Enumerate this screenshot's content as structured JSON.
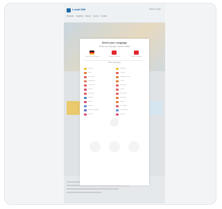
{
  "site": {
    "logo_text": "Locali NW",
    "top_link": "Partner login",
    "nav": [
      "Startseite",
      "Angebote",
      "Reisen",
      "Service",
      "Kontakt"
    ]
  },
  "language_modal": {
    "title": "Select your Language",
    "subtitle": "Choose your language / Sprache wählen",
    "primary": [
      {
        "label": "Deutschland / Deutsch",
        "color": "#1a1a1a",
        "accent": "#dd1f26"
      },
      {
        "label": "Schweiz / Deutsch",
        "color": "#e3262e"
      },
      {
        "label": "Suisse / Français",
        "color": "#e3262e"
      }
    ],
    "other_heading": "Other languages",
    "left_languages": [
      "España",
      "Italia",
      "Português",
      "Nederland",
      "Österreich",
      "Polska",
      "Danmark",
      "Sverige",
      "Norge",
      "Ελλάδα",
      "United Kingdom",
      "Россия"
    ],
    "right_languages": [
      "Belgique",
      "Türkiye",
      "Magyarország",
      "Česko",
      "Hrvatska",
      "Suomi",
      "Slovensko",
      "România",
      "Ireland",
      "България",
      "Luxembourg",
      "Србија"
    ],
    "left_colors": [
      "#f2c230",
      "#e07a2f",
      "#e0595a",
      "#e67a5a",
      "#e0595a",
      "#d9486b",
      "#e0595a",
      "#4d7bd1",
      "#d9486b",
      "#5c8fd6",
      "#5d6fc4",
      "#d9486b"
    ],
    "right_colors": [
      "#f2c230",
      "#e0595a",
      "#e07a2f",
      "#e07a2f",
      "#e0595a",
      "#e0595a",
      "#e0595a",
      "#e07a2f",
      "#e07a2f",
      "#e0595a",
      "#5c8fd6",
      "#d9486b"
    ]
  }
}
